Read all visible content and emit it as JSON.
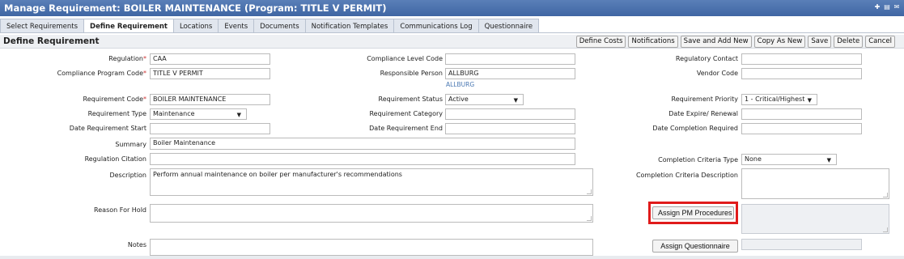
{
  "window": {
    "title": "Manage Requirement: BOILER MAINTENANCE (Program: TITLE V PERMIT)",
    "icons": [
      "expand-icon",
      "print-icon",
      "mail-icon"
    ]
  },
  "tabs": [
    {
      "label": "Select Requirements",
      "active": false
    },
    {
      "label": "Define Requirement",
      "active": true
    },
    {
      "label": "Locations",
      "active": false
    },
    {
      "label": "Events",
      "active": false
    },
    {
      "label": "Documents",
      "active": false
    },
    {
      "label": "Notification Templates",
      "active": false
    },
    {
      "label": "Communications Log",
      "active": false
    },
    {
      "label": "Questionnaire",
      "active": false
    }
  ],
  "header": {
    "title": "Define Requirement",
    "buttons": {
      "define_costs": "Define Costs",
      "notifications": "Notifications",
      "save_add_new": "Save and Add New",
      "copy_as_new": "Copy As New",
      "save": "Save",
      "delete": "Delete",
      "cancel": "Cancel"
    }
  },
  "form": {
    "regulation": {
      "label": "Regulation",
      "value": "CAA"
    },
    "compliance_program_code": {
      "label": "Compliance Program Code",
      "value": "TITLE V PERMIT"
    },
    "requirement_code": {
      "label": "Requirement Code",
      "value": "BOILER MAINTENANCE"
    },
    "requirement_type": {
      "label": "Requirement Type",
      "value": "Maintenance"
    },
    "date_requirement_start": {
      "label": "Date Requirement Start",
      "value": ""
    },
    "summary": {
      "label": "Summary",
      "value": "Boiler Maintenance"
    },
    "regulation_citation": {
      "label": "Regulation Citation",
      "value": ""
    },
    "description": {
      "label": "Description",
      "value": "Perform annual maintenance on boiler per manufacturer's recommendations"
    },
    "reason_for_hold": {
      "label": "Reason For Hold",
      "value": ""
    },
    "notes": {
      "label": "Notes",
      "value": ""
    },
    "compliance_level_code": {
      "label": "Compliance Level Code",
      "value": ""
    },
    "responsible_person": {
      "label": "Responsible Person",
      "value": "ALLBURG",
      "link": "ALLBURG"
    },
    "requirement_status": {
      "label": "Requirement Status",
      "value": "Active"
    },
    "requirement_category": {
      "label": "Requirement Category",
      "value": ""
    },
    "date_requirement_end": {
      "label": "Date Requirement End",
      "value": ""
    },
    "regulatory_contact": {
      "label": "Regulatory Contact",
      "value": ""
    },
    "vendor_code": {
      "label": "Vendor Code",
      "value": ""
    },
    "requirement_priority": {
      "label": "Requirement Priority",
      "value": "1 - Critical/Highest"
    },
    "date_expire_renewal": {
      "label": "Date Expire/ Renewal",
      "value": ""
    },
    "date_completion_required": {
      "label": "Date Completion Required",
      "value": ""
    },
    "completion_criteria_type": {
      "label": "Completion Criteria Type",
      "value": "None"
    },
    "completion_criteria_description": {
      "label": "Completion Criteria Description",
      "value": ""
    },
    "assign_pm_procedures": "Assign PM Procedures",
    "assign_questionnaire": "Assign Questionnaire",
    "required_marker": "*"
  },
  "colors": {
    "title_bar": "#4a6fae",
    "highlight": "#e01b1b",
    "link": "#4a78b3"
  }
}
